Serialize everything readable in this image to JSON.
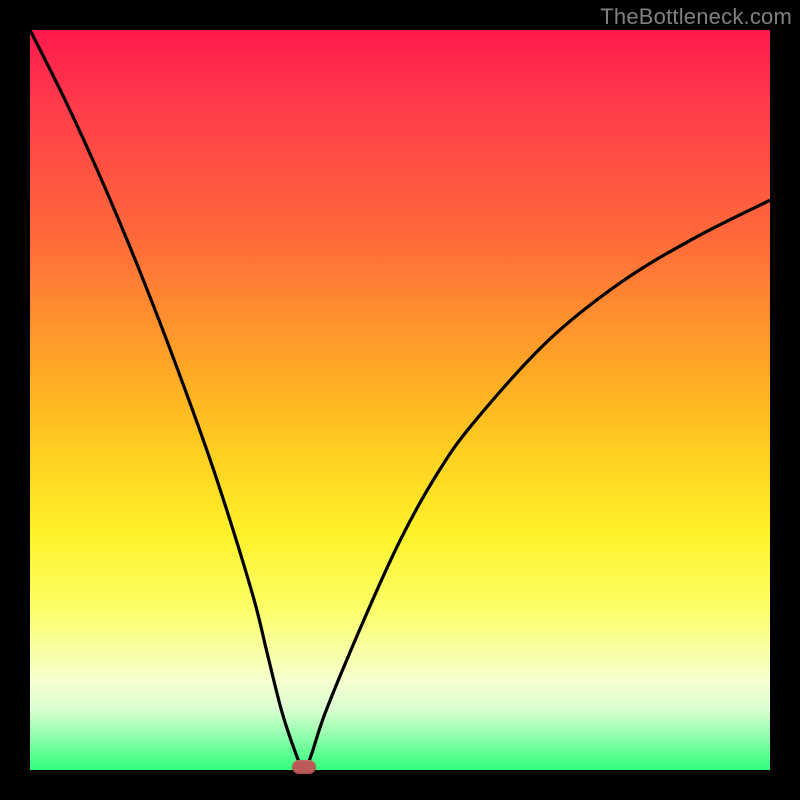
{
  "watermark": "TheBottleneck.com",
  "chart_data": {
    "type": "line",
    "title": "",
    "xlabel": "",
    "ylabel": "",
    "xlim": [
      0,
      100
    ],
    "ylim": [
      0,
      100
    ],
    "grid": false,
    "legend": false,
    "series": [
      {
        "name": "bottleneck-curve",
        "x": [
          0,
          5,
          10,
          15,
          20,
          25,
          30,
          32,
          34,
          36,
          37,
          38,
          40,
          45,
          50,
          55,
          60,
          70,
          80,
          90,
          100
        ],
        "values": [
          100,
          90,
          79,
          67,
          54,
          40,
          24,
          16,
          8,
          2,
          0,
          2,
          8,
          20,
          31,
          40,
          47,
          58,
          66,
          72,
          77
        ]
      }
    ],
    "marker": {
      "x": 37,
      "y": 0,
      "color": "#bb5a56"
    },
    "background_gradient": {
      "stops": [
        {
          "pos": 0,
          "color": "#ff1a4d"
        },
        {
          "pos": 28,
          "color": "#ff6a3a"
        },
        {
          "pos": 55,
          "color": "#ffc81f"
        },
        {
          "pos": 78,
          "color": "#fbff66"
        },
        {
          "pos": 92,
          "color": "#d8ffd0"
        },
        {
          "pos": 100,
          "color": "#2eff7a"
        }
      ]
    }
  }
}
